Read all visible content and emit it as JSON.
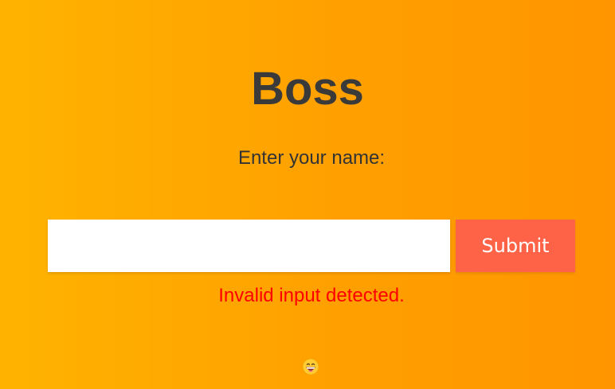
{
  "page": {
    "title": "Boss",
    "prompt": "Enter your name:",
    "background_colors": [
      "#ffb300",
      "#ff9500"
    ]
  },
  "form": {
    "name_value": "",
    "submit_label": "Submit",
    "submit_color": "#ff6347"
  },
  "message": {
    "error": "Invalid input detected.",
    "error_color": "#ff0000"
  },
  "footer": {
    "emoji_icon": "grinning-face-icon"
  }
}
